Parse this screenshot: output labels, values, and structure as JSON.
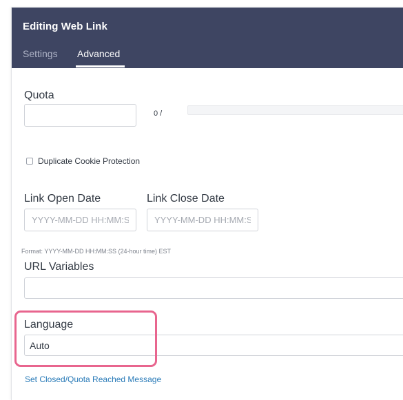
{
  "header": {
    "title": "Editing Web Link",
    "tabs": [
      {
        "label": "Settings",
        "active": false
      },
      {
        "label": "Advanced",
        "active": true
      }
    ]
  },
  "quota": {
    "label": "Quota",
    "value": "",
    "count_text": "0 /"
  },
  "duplicate_cookie": {
    "label": "Duplicate Cookie Protection",
    "checked": false
  },
  "link_open_date": {
    "label": "Link Open Date",
    "placeholder": "YYYY-MM-DD HH:MM:SS"
  },
  "link_close_date": {
    "label": "Link Close Date",
    "placeholder": "YYYY-MM-DD HH:MM:SS"
  },
  "format_hint": "Format: YYYY-MM-DD HH:MM:SS (24-hour time) EST",
  "url_variables": {
    "label": "URL Variables",
    "value": ""
  },
  "language": {
    "label": "Language",
    "selected": "Auto"
  },
  "closed_message_link": "Set Closed/Quota Reached Message",
  "colors": {
    "header_bg": "#3e4562",
    "highlight_border": "#e8658e",
    "link": "#2a7bb8"
  }
}
